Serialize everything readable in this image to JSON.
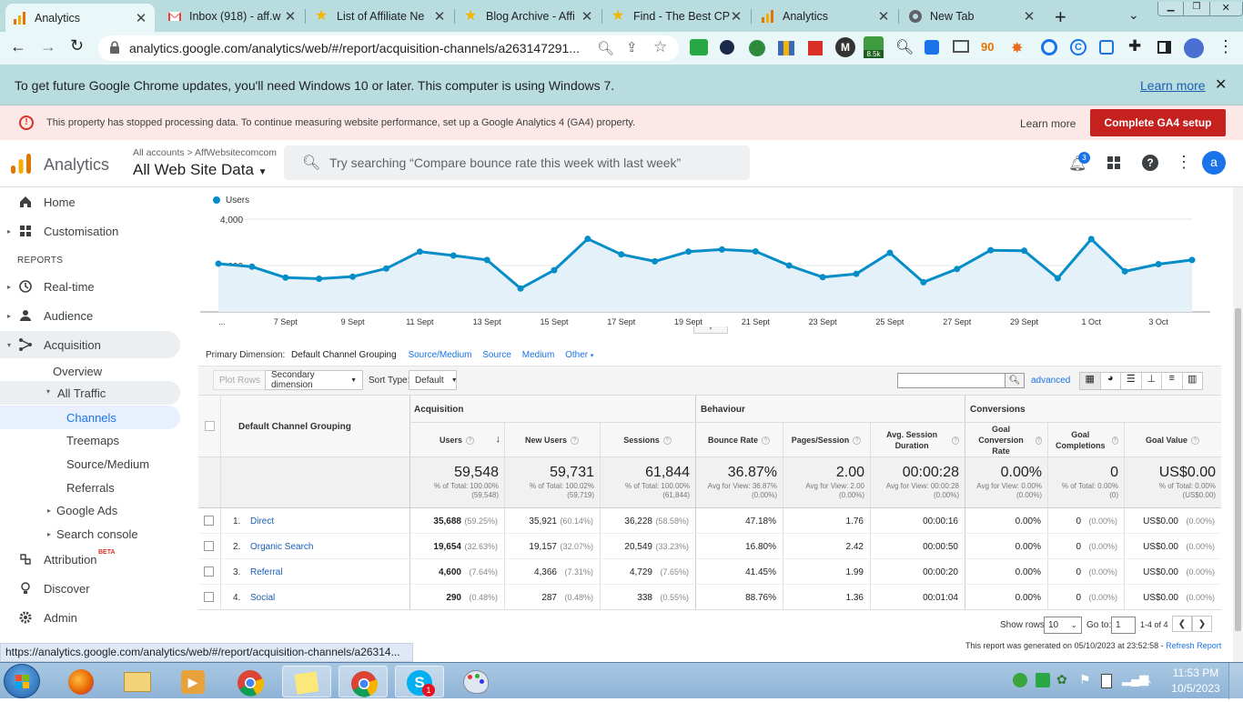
{
  "browser": {
    "tabs": [
      {
        "title": "Analytics",
        "active": true
      },
      {
        "title": "Inbox (918) - aff.w",
        "active": false
      },
      {
        "title": "List of Affiliate Ne",
        "active": false
      },
      {
        "title": "Blog Archive - Affi",
        "active": false
      },
      {
        "title": "Find - The Best CP",
        "active": false
      },
      {
        "title": "Analytics",
        "active": false
      },
      {
        "title": "New Tab",
        "active": false
      }
    ],
    "url": "analytics.google.com/analytics/web/#/report/acquisition-channels/a263147291...",
    "extension_badge": "8.5k",
    "infobar_text": "To get future Google Chrome updates, you'll need Windows 10 or later. This computer is using Windows 7.",
    "infobar_link": "Learn more",
    "status_url": "https://analytics.google.com/analytics/web/#/report/acquisition-channels/a26314..."
  },
  "alert": {
    "text": "This property has stopped processing data. To continue measuring website performance, set up a Google Analytics 4 (GA4) property.",
    "learn_more": "Learn more",
    "cta": "Complete GA4 setup"
  },
  "header": {
    "product": "Analytics",
    "breadcrumb": "All accounts > AffWebsitecomcom",
    "property": "All Web Site Data",
    "search_placeholder": "Try searching “Compare bounce rate this week with last week”",
    "notif_count": "3",
    "avatar": "a"
  },
  "sidebar": {
    "home": "Home",
    "customisation": "Customisation",
    "reports_heading": "REPORTS",
    "realtime": "Real-time",
    "audience": "Audience",
    "acquisition": "Acquisition",
    "overview": "Overview",
    "all_traffic": "All Traffic",
    "channels": "Channels",
    "treemaps": "Treemaps",
    "source_medium": "Source/Medium",
    "referrals": "Referrals",
    "google_ads": "Google Ads",
    "search_console": "Search console",
    "attribution": "Attribution",
    "beta": "BETA",
    "discover": "Discover",
    "admin": "Admin"
  },
  "chart_data": {
    "type": "area",
    "legend": [
      "Users"
    ],
    "ytick_labels": [
      "4,000",
      "2,000"
    ],
    "ylim": [
      0,
      4000
    ],
    "xtick_labels": [
      "...",
      "7 Sept",
      "9 Sept",
      "11 Sept",
      "13 Sept",
      "15 Sept",
      "17 Sept",
      "19 Sept",
      "21 Sept",
      "23 Sept",
      "25 Sept",
      "27 Sept",
      "29 Sept",
      "1 Oct",
      "3 Oct"
    ],
    "x": [
      "5 Sept",
      "6 Sept",
      "7 Sept",
      "8 Sept",
      "9 Sept",
      "10 Sept",
      "11 Sept",
      "12 Sept",
      "13 Sept",
      "14 Sept",
      "15 Sept",
      "16 Sept",
      "17 Sept",
      "18 Sept",
      "19 Sept",
      "20 Sept",
      "21 Sept",
      "22 Sept",
      "23 Sept",
      "24 Sept",
      "25 Sept",
      "26 Sept",
      "27 Sept",
      "28 Sept",
      "29 Sept",
      "30 Sept",
      "1 Oct",
      "2 Oct",
      "3 Oct",
      "4 Oct"
    ],
    "series": [
      {
        "name": "Users",
        "values": [
          2080,
          1950,
          1480,
          1430,
          1520,
          1870,
          2600,
          2430,
          2240,
          1010,
          1800,
          3150,
          2480,
          2180,
          2600,
          2690,
          2610,
          2000,
          1500,
          1640,
          2550,
          1280,
          1850,
          2660,
          2640,
          1450,
          3140,
          1750,
          2060,
          2240
        ],
        "color": "#058dc7"
      }
    ]
  },
  "dimension_bar": {
    "label": "Primary Dimension:",
    "active": "Default Channel Grouping",
    "options": [
      "Source/Medium",
      "Source",
      "Medium",
      "Other"
    ]
  },
  "controls": {
    "plot_rows": "Plot Rows",
    "secondary_dimension": "Secondary dimension",
    "sort_type_label": "Sort Type:",
    "sort_type": "Default",
    "advanced": "advanced"
  },
  "table": {
    "groups": [
      "Acquisition",
      "Behaviour",
      "Conversions"
    ],
    "dim_header": "Default Channel Grouping",
    "columns": [
      "Users",
      "New Users",
      "Sessions",
      "Bounce Rate",
      "Pages/Session",
      "Avg. Session Duration",
      "Goal Conversion Rate",
      "Goal Completions",
      "Goal Value"
    ],
    "totals": [
      {
        "value": "59,548",
        "sub": "% of Total: 100.00% (59,548)"
      },
      {
        "value": "59,731",
        "sub": "% of Total: 100.02% (59,719)"
      },
      {
        "value": "61,844",
        "sub": "% of Total: 100.00% (61,844)"
      },
      {
        "value": "36.87%",
        "sub": "Avg for View: 36.87% (0.00%)"
      },
      {
        "value": "2.00",
        "sub": "Avg for View: 2.00 (0.00%)"
      },
      {
        "value": "00:00:28",
        "sub": "Avg for View: 00:00:28 (0.00%)"
      },
      {
        "value": "0.00%",
        "sub": "Avg for View: 0.00% (0.00%)"
      },
      {
        "value": "0",
        "sub": "% of Total: 0.00% (0)"
      },
      {
        "value": "US$0.00",
        "sub": "% of Total: 0.00% (US$0.00)"
      }
    ],
    "rows": [
      {
        "idx": "1.",
        "name": "Direct",
        "users": "35,688",
        "users_pct": "(59.25%)",
        "new_users": "35,921",
        "new_users_pct": "(60.14%)",
        "sessions": "36,228",
        "sessions_pct": "(58.58%)",
        "bounce": "47.18%",
        "pps": "1.76",
        "dur": "00:00:16",
        "gcr": "0.00%",
        "gc": "0",
        "gc_pct": "(0.00%)",
        "gv": "US$0.00",
        "gv_pct": "(0.00%)"
      },
      {
        "idx": "2.",
        "name": "Organic Search",
        "users": "19,654",
        "users_pct": "(32.63%)",
        "new_users": "19,157",
        "new_users_pct": "(32.07%)",
        "sessions": "20,549",
        "sessions_pct": "(33.23%)",
        "bounce": "16.80%",
        "pps": "2.42",
        "dur": "00:00:50",
        "gcr": "0.00%",
        "gc": "0",
        "gc_pct": "(0.00%)",
        "gv": "US$0.00",
        "gv_pct": "(0.00%)"
      },
      {
        "idx": "3.",
        "name": "Referral",
        "users": "4,600",
        "users_pct": "(7.64%)",
        "new_users": "4,366",
        "new_users_pct": "(7.31%)",
        "sessions": "4,729",
        "sessions_pct": "(7.65%)",
        "bounce": "41.45%",
        "pps": "1.99",
        "dur": "00:00:20",
        "gcr": "0.00%",
        "gc": "0",
        "gc_pct": "(0.00%)",
        "gv": "US$0.00",
        "gv_pct": "(0.00%)"
      },
      {
        "idx": "4.",
        "name": "Social",
        "users": "290",
        "users_pct": "(0.48%)",
        "new_users": "287",
        "new_users_pct": "(0.48%)",
        "sessions": "338",
        "sessions_pct": "(0.55%)",
        "bounce": "88.76%",
        "pps": "1.36",
        "dur": "00:01:04",
        "gcr": "0.00%",
        "gc": "0",
        "gc_pct": "(0.00%)",
        "gv": "US$0.00",
        "gv_pct": "(0.00%)"
      }
    ]
  },
  "pager": {
    "show_rows_label": "Show rows:",
    "show_rows": "10",
    "goto_label": "Go to:",
    "goto": "1",
    "range": "1-4 of 4",
    "generated": "This report was generated on 05/10/2023 at 23:52:58 -",
    "refresh": "Refresh Report"
  },
  "taskbar": {
    "time": "11:53 PM",
    "date": "10/5/2023",
    "skype_badge": "1"
  }
}
